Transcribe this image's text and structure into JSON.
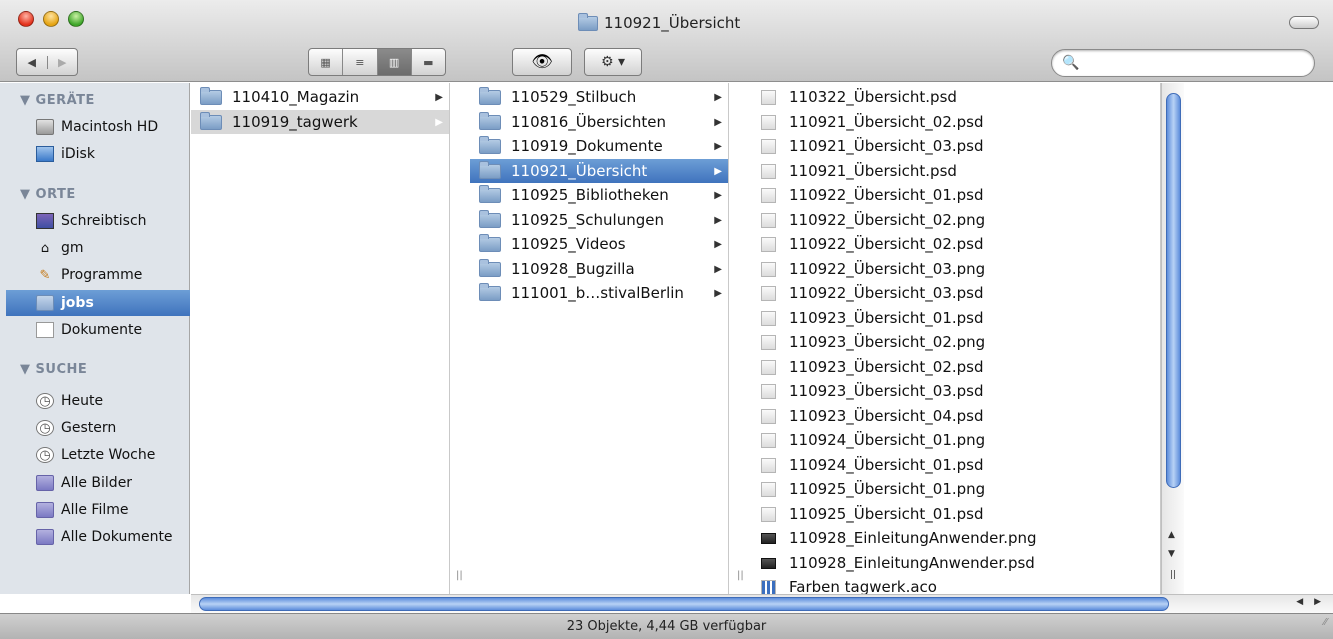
{
  "window": {
    "title": "110921_Übersicht"
  },
  "toolbar": {
    "back_icon": "◀",
    "forward_icon": "▶",
    "view_icons": [
      "▦",
      "≡",
      "▥",
      "▬"
    ],
    "quicklook_icon": "👁",
    "action_icon": "⚙ ▾",
    "search_icon": "🔍",
    "search_placeholder": ""
  },
  "sidebar": {
    "sections": [
      {
        "header": "▼ GERÄTE",
        "items": [
          {
            "label": "Macintosh HD",
            "icon": "hd-icon"
          },
          {
            "label": "iDisk",
            "icon": "idisk-icon"
          }
        ]
      },
      {
        "header": "▼ ORTE",
        "items": [
          {
            "label": "Schreibtisch",
            "icon": "desktop-icon"
          },
          {
            "label": "gm",
            "icon": "home-icon"
          },
          {
            "label": "Programme",
            "icon": "applications-icon"
          },
          {
            "label": "jobs",
            "icon": "folder-icon",
            "selected": true
          },
          {
            "label": "Dokumente",
            "icon": "document-icon"
          }
        ]
      },
      {
        "header": "▼ SUCHE",
        "items": [
          {
            "label": "Heute",
            "icon": "clock-icon"
          },
          {
            "label": "Gestern",
            "icon": "clock-icon"
          },
          {
            "label": "Letzte Woche",
            "icon": "clock-icon"
          },
          {
            "label": "Alle Bilder",
            "icon": "smart-folder-icon"
          },
          {
            "label": "Alle Filme",
            "icon": "smart-folder-icon"
          },
          {
            "label": "Alle Dokumente",
            "icon": "smart-folder-icon"
          }
        ]
      }
    ]
  },
  "columns": {
    "col1": [
      {
        "label": "110410_Magazin",
        "arrow": "▶"
      },
      {
        "label": "110919_tagwerk",
        "arrow": "▶"
      }
    ],
    "col2": [
      {
        "label": "110529_Stilbuch",
        "arrow": "▶"
      },
      {
        "label": "110816_Übersichten",
        "arrow": "▶"
      },
      {
        "label": "110919_Dokumente",
        "arrow": "▶"
      },
      {
        "label": "110921_Übersicht",
        "arrow": "▶"
      },
      {
        "label": "110925_Bibliotheken",
        "arrow": "▶"
      },
      {
        "label": "110925_Schulungen",
        "arrow": "▶"
      },
      {
        "label": "110925_Videos",
        "arrow": "▶"
      },
      {
        "label": "110928_Bugzilla",
        "arrow": "▶"
      },
      {
        "label": "111001_b…stivalBerlin",
        "arrow": "▶"
      }
    ],
    "col3": [
      "110322_Übersicht.psd",
      "110921_Übersicht_02.psd",
      "110921_Übersicht_03.psd",
      "110921_Übersicht.psd",
      "110922_Übersicht_01.psd",
      "110922_Übersicht_02.png",
      "110922_Übersicht_02.psd",
      "110922_Übersicht_03.png",
      "110922_Übersicht_03.psd",
      "110923_Übersicht_01.psd",
      "110923_Übersicht_02.png",
      "110923_Übersicht_02.psd",
      "110923_Übersicht_03.psd",
      "110923_Übersicht_04.psd",
      "110924_Übersicht_01.png",
      "110924_Übersicht_01.psd",
      "110925_Übersicht_01.png",
      "110925_Übersicht_01.psd",
      "110928_EinleitungAnwender.png",
      "110928_EinleitungAnwender.psd",
      "Farben tagwerk.aco"
    ]
  },
  "glyphs": {
    "column_handle": "||",
    "scroll_up": "▲",
    "scroll_down": "▼",
    "scroll_left_right": "◀ ▶",
    "resize_grip": "⁄⁄"
  },
  "status": {
    "text": "23 Objekte, 4,44 GB verfügbar"
  },
  "colors": {
    "selection": "#3f73bd",
    "sidebar_bg": "#dfe4ea"
  }
}
